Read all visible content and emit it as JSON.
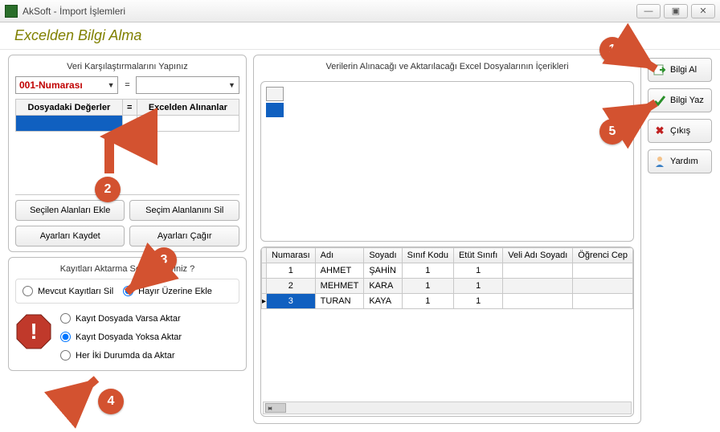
{
  "window": {
    "title": "AkSoft - İmport İşlemleri"
  },
  "header": {
    "title": "Excelden Bilgi Alma"
  },
  "left": {
    "group1_title": "Veri Karşılaştırmalarını Yapınız",
    "combo_selected": "001-Numarası",
    "eq": "=",
    "th_left": "Dosyadaki Değerler",
    "th_eq": "=",
    "th_right": "Excelden Alınanlar",
    "btn_add_selected": "Seçilen Alanları Ekle",
    "btn_del_selection": "Seçim Alanlanını Sil",
    "btn_save_settings": "Ayarları Kaydet",
    "btn_call_settings": "Ayarları Çağır",
    "group2_title": "Kayıtları Aktarma Seçenekleriniz ?",
    "radio_delete": "Mevcut Kayıtları Sil",
    "radio_append": "Hayır Üzerine Ekle",
    "radio_if_exists": "Kayıt Dosyada Varsa Aktar",
    "radio_if_not_exists": "Kayıt Dosyada Yoksa Aktar",
    "radio_both": "Her İki Durumda da Aktar"
  },
  "center": {
    "title": "Verilerin Alınacağı ve Aktarılacağı Excel Dosyalarının İçerikleri",
    "columns": [
      "Numarası",
      "Adı",
      "Soyadı",
      "Sınıf Kodu",
      "Etüt Sınıfı",
      "Veli Adı Soyadı",
      "Öğrenci Cep"
    ],
    "rows": [
      {
        "no": "1",
        "ad": "AHMET",
        "soyad": "ŞAHİN",
        "sinif": "1",
        "etut": "1",
        "veli": "",
        "cep": ""
      },
      {
        "no": "2",
        "ad": "MEHMET",
        "soyad": "KARA",
        "sinif": "1",
        "etut": "1",
        "veli": "",
        "cep": ""
      },
      {
        "no": "3",
        "ad": "TURAN",
        "soyad": "KAYA",
        "sinif": "1",
        "etut": "1",
        "veli": "",
        "cep": ""
      }
    ]
  },
  "right": {
    "btn_get": "Bilgi Al",
    "btn_write": "Bilgi Yaz",
    "btn_exit": "Çıkış",
    "btn_help": "Yardım"
  },
  "annotations": {
    "n1": "1",
    "n2": "2",
    "n3": "3",
    "n4": "4",
    "n5": "5",
    "bang": "!"
  }
}
